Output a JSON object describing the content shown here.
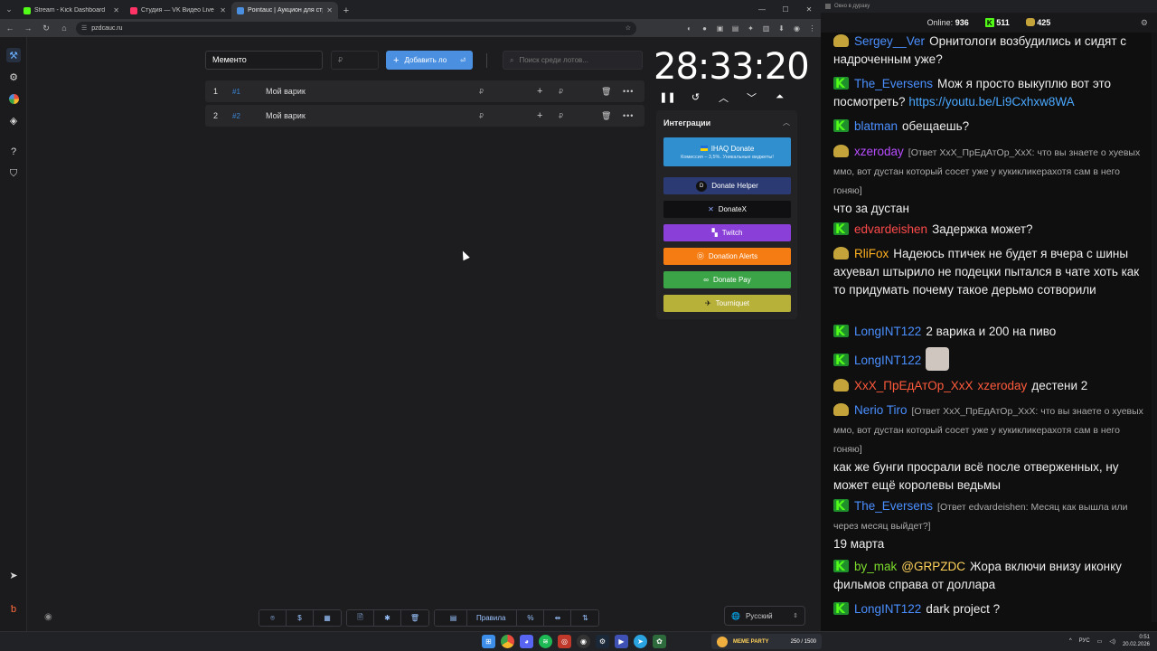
{
  "browser": {
    "tabs": [
      {
        "title": "Stream - Kick Dashboard",
        "color": "#53fc18"
      },
      {
        "title": "Студия — VK Видео Live",
        "color": "#ff3366"
      },
      {
        "title": "Pointauc | Аукцион для стримеров",
        "color": "#4a8fe0"
      }
    ],
    "url": "pzdcauc.ru"
  },
  "auction": {
    "lot_name_value": "Мементо",
    "amount_placeholder": "₽",
    "add_button_label": "Добавить ло",
    "search_placeholder": "Поиск среди лотов...",
    "lots": [
      {
        "num": "1",
        "fast_id": "#1",
        "name": "Мой варик",
        "currency": "₽"
      },
      {
        "num": "2",
        "fast_id": "#2",
        "name": "Мой варик",
        "currency": "₽"
      }
    ],
    "timer": "28:33:20"
  },
  "integrations": {
    "title": "Интеграции",
    "buttons": [
      {
        "label": "IHAQ Donate",
        "sub": "Комиссия – 3,5%. Уникальные виджеты!",
        "color": "#2f8fcf"
      },
      {
        "label": "Donate Helper",
        "color": "#2b3a73"
      },
      {
        "label": "DonateX",
        "color": "#101012"
      },
      {
        "label": "Twitch",
        "color": "#8a3fd8"
      },
      {
        "label": "Donation Alerts",
        "color": "#f57c13"
      },
      {
        "label": "Donate Pay",
        "color": "#3ba447"
      },
      {
        "label": "Tourniquet",
        "color": "#b7b039"
      }
    ]
  },
  "footer": {
    "rules_label": "Правила",
    "percent_label": "%",
    "language": "Русский"
  },
  "chat": {
    "window_title": "Окно в дураку",
    "online_label": "Online:",
    "online_count": "936",
    "kick_count": "511",
    "other_count": "425",
    "messages": [
      {
        "badge": "av",
        "user": "Sergey__Ver",
        "color": "#4a8fff",
        "text": "Орнитологи возбудились и сидят с надроченным уже?"
      },
      {
        "badge": "k",
        "user": "The_Eversens",
        "color": "#4a8fff",
        "text": "Мож я просто выкуплю вот это посмотреть?",
        "link": "https://youtu.be/Li9Cxhxw8WA"
      },
      {
        "badge": "k",
        "user": "blatman",
        "color": "#4a8fff",
        "text": "обещаешь?"
      },
      {
        "badge": "av",
        "user": "xzeroday",
        "color": "#b84dff",
        "reply": "[Ответ XxX_ПрЕдАтОр_XxX: что вы знаете о хуевых ммо, вот дустан который сосет уже у кукикликерахотя сам в него гоняю]",
        "text": "что за дустан"
      },
      {
        "badge": "k",
        "user": "edvardeishen",
        "color": "#ff4a4a",
        "text": "Задержка может?"
      },
      {
        "badge": "av",
        "user": "RliFox",
        "color": "#ffb020",
        "text": "Надеюсь птичек не будет я вчера с шины ахуевал штырило не подецки пытался в чате хоть как то придумать почему такое дерьмо сотворили"
      },
      {
        "badge": "k",
        "user": "LongINT122",
        "color": "#4a8fff",
        "text": "2 варика и 200 на пиво"
      },
      {
        "badge": "k",
        "user": "LongINT122",
        "color": "#4a8fff",
        "text": ""
      },
      {
        "badge": "av",
        "user": "XxX_ПрЕдАтОр_XxX",
        "color": "#ff5a3c",
        "mention": "xzeroday",
        "text": "дестени 2"
      },
      {
        "badge": "av",
        "user": "Nerio Tiro",
        "color": "#4a8fff",
        "reply": "[Ответ XxX_ПрЕдАтОр_XxX: что вы знаете о хуевых ммо, вот дустан который сосет уже у кукикликерахотя сам в него гоняю]",
        "text": "как же бунги просрали всё после отверженных, ну может ещё королевы ведьмы"
      },
      {
        "badge": "k",
        "user": "The_Eversens",
        "color": "#4a8fff",
        "reply": "[Ответ edvardeishen: Месяц как вышла или через месяц выйдет?]",
        "text": "19 марта"
      },
      {
        "badge": "k",
        "user": "by_mak",
        "color": "#7cdc2c",
        "mention": "@GRPZDC",
        "text": "Жора включи внизу иконку фильмов справа от доллара"
      },
      {
        "badge": "k",
        "user": "LongINT122",
        "color": "#4a8fff",
        "text": "dark project ?"
      }
    ]
  },
  "taskbar": {
    "widget_text": "MEME PARTY",
    "widget_progress": "250 / 1500",
    "lang": "РУС",
    "time": "0:51",
    "date": "20.02.2026"
  }
}
